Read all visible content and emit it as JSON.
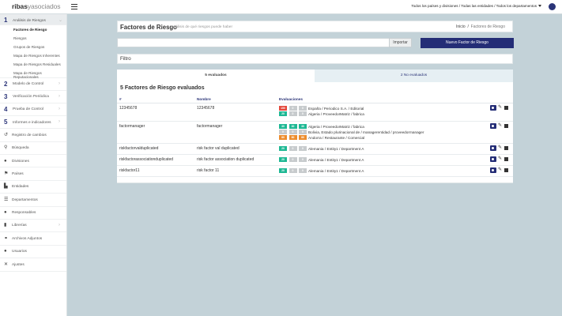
{
  "topbar": {
    "logo_bold": "ribas",
    "logo_light": "yasociados",
    "scope": "Todos los países y divisiones / Todas las entidades / Todos los departamentos"
  },
  "sidebar": {
    "sections": [
      {
        "num": "1",
        "label": "Análisis de Riesgos"
      },
      {
        "num": "2",
        "label": "Modelo de Control"
      },
      {
        "num": "3",
        "label": "Verificación Periódica"
      },
      {
        "num": "4",
        "label": "Prueba de Control"
      },
      {
        "num": "5",
        "label": "Informes e indicadores"
      }
    ],
    "subitems": [
      "Factores de Riesgo",
      "Riesgos",
      "Grupos de Riesgos",
      "Mapa de Riesgos Inherentes",
      "Mapa de Riesgos Residuales",
      "Mapa de Riesgos Reputacionales"
    ],
    "items": [
      {
        "icon": "history-icon",
        "label": "Registro de cambios"
      },
      {
        "icon": "search-icon",
        "label": "Búsqueda"
      },
      {
        "icon": "globe-icon",
        "label": "Divisiones"
      },
      {
        "icon": "flag-icon",
        "label": "Países"
      },
      {
        "icon": "sitemap-icon",
        "label": "Entidades"
      },
      {
        "icon": "list-icon",
        "label": "Departamentos"
      },
      {
        "icon": "users-icon",
        "label": "Responsables"
      },
      {
        "icon": "book-icon",
        "label": "Librerías"
      },
      {
        "icon": "paperclip-icon",
        "label": "Archivos Adjuntos"
      },
      {
        "icon": "user-icon",
        "label": "Usuarios"
      },
      {
        "icon": "wrench-icon",
        "label": "Ajustes"
      }
    ]
  },
  "page": {
    "title": "Factores de Riesgo",
    "subtitle": "análisis de qué riesgos puede haber",
    "breadcrumb_home": "Inicio",
    "breadcrumb_sep": "/",
    "breadcrumb_current": "Factores de Riesgo"
  },
  "toolbar": {
    "search_value": "",
    "import_label": "Importar",
    "new_label": "Nuevo Factor de Riesgo"
  },
  "filter": {
    "label": "Filtro"
  },
  "tabs": {
    "evaluated": "5 evaluados",
    "not_evaluated": "2 No evaluados"
  },
  "table": {
    "title": "5 Factores de Riesgo evaluados",
    "headers": {
      "id": "#",
      "name": "Nombre",
      "evals": "Evaluaciones"
    },
    "rows": [
      {
        "id": "12345678",
        "name": "12345678",
        "evals": [
          {
            "badges": [
              {
                "v": "150",
                "c": "red"
              },
              {
                "v": "0",
                "c": "gray"
              },
              {
                "v": "0",
                "c": "gray"
              }
            ],
            "text": "España / Periodico S.A. / Editorial"
          },
          {
            "badges": [
              {
                "v": "20",
                "c": "green"
              },
              {
                "v": "0",
                "c": "gray"
              },
              {
                "v": "0",
                "c": "gray"
              }
            ],
            "text": "Algeria / ProveedorMatriz / fabrica"
          }
        ]
      },
      {
        "id": "factormanager",
        "name": "factormanager",
        "evals": [
          {
            "badges": [
              {
                "v": "30",
                "c": "green"
              },
              {
                "v": "30",
                "c": "green"
              },
              {
                "v": "30",
                "c": "green"
              }
            ],
            "text": "Algeria / ProveedorMatriz / fabrica"
          },
          {
            "badges": [
              {
                "v": "0",
                "c": "gray"
              },
              {
                "v": "0",
                "c": "gray"
              },
              {
                "v": "0",
                "c": "gray"
              }
            ],
            "text": "Bolivia, Estado plurinacional de / managerentidad / proveedormanager"
          },
          {
            "badges": [
              {
                "v": "80",
                "c": "orange"
              },
              {
                "v": "80",
                "c": "orange"
              },
              {
                "v": "80",
                "c": "orange"
              }
            ],
            "text": "Andorra / Restaurante / Comercial"
          }
        ]
      },
      {
        "id": "riskfactorvalduplicated",
        "name": "risk factor val duplicated",
        "evals": [
          {
            "badges": [
              {
                "v": "20",
                "c": "green"
              },
              {
                "v": "0",
                "c": "gray"
              },
              {
                "v": "0",
                "c": "gray"
              }
            ],
            "text": "Alemania / Entity1 / Department A"
          }
        ]
      },
      {
        "id": "riskfactorassociationduplicated",
        "name": "risk factor association duplicated",
        "evals": [
          {
            "badges": [
              {
                "v": "20",
                "c": "green"
              },
              {
                "v": "0",
                "c": "gray"
              },
              {
                "v": "0",
                "c": "gray"
              }
            ],
            "text": "Alemania / Entity1 / Department A"
          }
        ]
      },
      {
        "id": "riskfactor11",
        "name": "risk factor 11",
        "evals": [
          {
            "badges": [
              {
                "v": "20",
                "c": "green"
              },
              {
                "v": "0",
                "c": "gray"
              },
              {
                "v": "0",
                "c": "gray"
              }
            ],
            "text": "Alemania / Entity1 / Department A"
          }
        ]
      }
    ]
  },
  "colors": {
    "brand": "#242d76",
    "green": "#1eb894",
    "red": "#e3473b",
    "orange": "#ec8c2d",
    "gray": "#c7cbcd",
    "background": "#c3d2d8"
  }
}
